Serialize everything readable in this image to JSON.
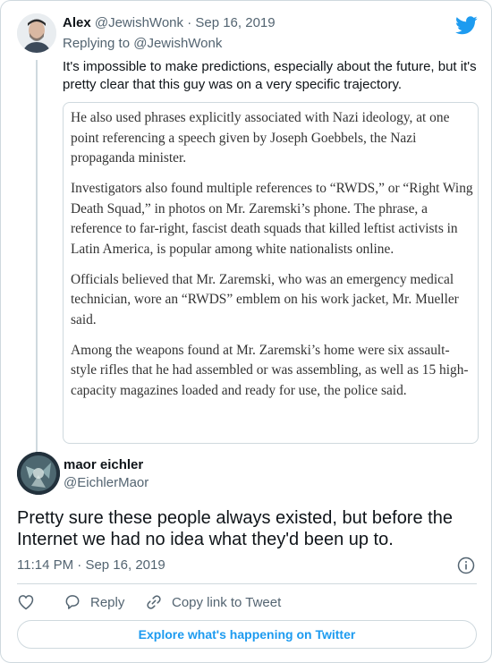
{
  "parent_tweet": {
    "name": "Alex",
    "handle": "@JewishWonk",
    "separator": "·",
    "date": "Sep 16, 2019",
    "replying_to": "Replying to @JewishWonk",
    "text": "It's impossible to make predictions, especially about the future, but it's pretty clear that this guy was on a very specific trajectory.",
    "quoted_article": {
      "paragraphs": [
        "He also used phrases explicitly associated with Nazi ideology, at one point referencing a speech given by Joseph Goebbels, the Nazi propaganda minister.",
        "Investigators also found multiple references to “RWDS,” or “Right Wing Death Squad,” in photos on Mr. Zaremski’s phone. The phrase, a reference to far-right, fascist death squads that killed leftist activists in Latin America, is popular among white nationalists online.",
        "Officials believed that Mr. Zaremski, who was an emergency medical technician, wore an “RWDS” emblem on his work jacket, Mr. Mueller said.",
        "Among the weapons found at Mr. Zaremski’s home were six assault-style rifles that he had assembled or was assembling, as well as 15 high-capacity magazines loaded and ready for use, the police said."
      ]
    }
  },
  "main_tweet": {
    "name": "maor eichler",
    "handle": "@EichlerMaor",
    "text": "Pretty sure these people always existed, but before the Internet we had no idea what they'd been up to.",
    "time": "11:14 PM",
    "separator": "·",
    "date": "Sep 16, 2019"
  },
  "actions": {
    "reply_label": "Reply",
    "copy_link_label": "Copy link to Tweet"
  },
  "explore_label": "Explore what's happening on Twitter",
  "colors": {
    "twitter_blue": "#1d9bf0",
    "muted_text": "#536471",
    "border": "#cfd9de"
  },
  "icons": [
    "twitter-bird-icon",
    "info-icon",
    "heart-icon",
    "reply-icon",
    "link-icon"
  ]
}
